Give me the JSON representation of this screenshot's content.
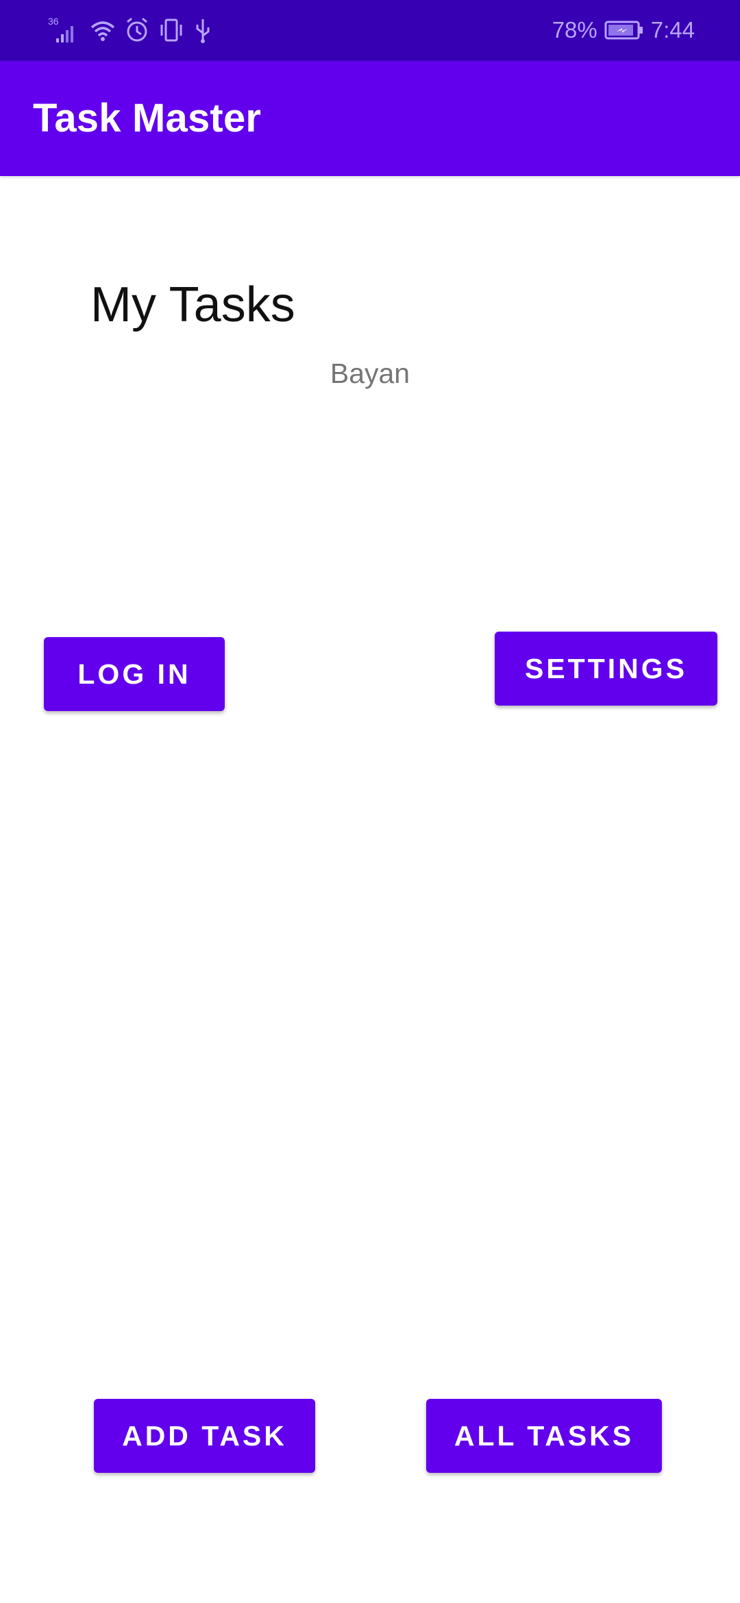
{
  "status_bar": {
    "network": "36",
    "battery_percent": "78%",
    "time": "7:44",
    "icons": [
      "signal-icon",
      "wifi-icon",
      "alarm-icon",
      "vibrate-icon",
      "usb-icon",
      "battery-charging-icon"
    ],
    "background_color": "#3700B3"
  },
  "app_bar": {
    "title": "Task Master",
    "background_color": "#6200EE"
  },
  "main": {
    "heading": "My Tasks",
    "username": "Bayan"
  },
  "buttons": {
    "login": "LOG IN",
    "settings": "SETTINGS",
    "add_task": "ADD TASK",
    "all_tasks": "ALL TASKS",
    "color": "#6200EE"
  }
}
